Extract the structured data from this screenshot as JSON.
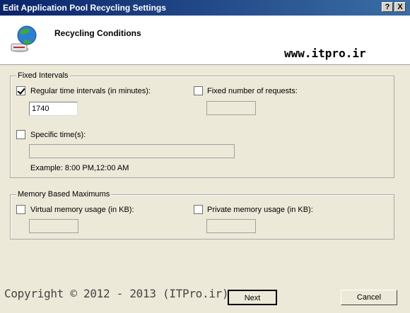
{
  "window": {
    "title": "Edit Application Pool Recycling Settings",
    "help_label": "?",
    "close_label": "X"
  },
  "header": {
    "title": "Recycling Conditions",
    "watermark": "www.itpro.ir"
  },
  "fixed_intervals": {
    "legend": "Fixed Intervals",
    "regular_time": {
      "label": "Regular time intervals (in minutes):",
      "checked": true,
      "value": "1740"
    },
    "fixed_requests": {
      "label": "Fixed number of requests:",
      "checked": false,
      "value": ""
    },
    "specific_times": {
      "label": "Specific time(s):",
      "checked": false,
      "value": "",
      "example": "Example: 8:00 PM,12:00 AM"
    }
  },
  "memory_maximums": {
    "legend": "Memory Based Maximums",
    "virtual_memory": {
      "label": "Virtual memory usage (in KB):",
      "checked": false,
      "value": ""
    },
    "private_memory": {
      "label": "Private memory usage (in KB):",
      "checked": false,
      "value": ""
    }
  },
  "footer": {
    "watermark": "Copyright © 2012 - 2013 (ITPro.ir)",
    "next_label": "Next",
    "cancel_label": "Cancel"
  },
  "colors": {
    "titlebar_start": "#0a246a",
    "titlebar_end": "#3a6ea5",
    "dialog_bg": "#ece9d8"
  },
  "icons": {
    "header": "globe-recycle-icon"
  }
}
